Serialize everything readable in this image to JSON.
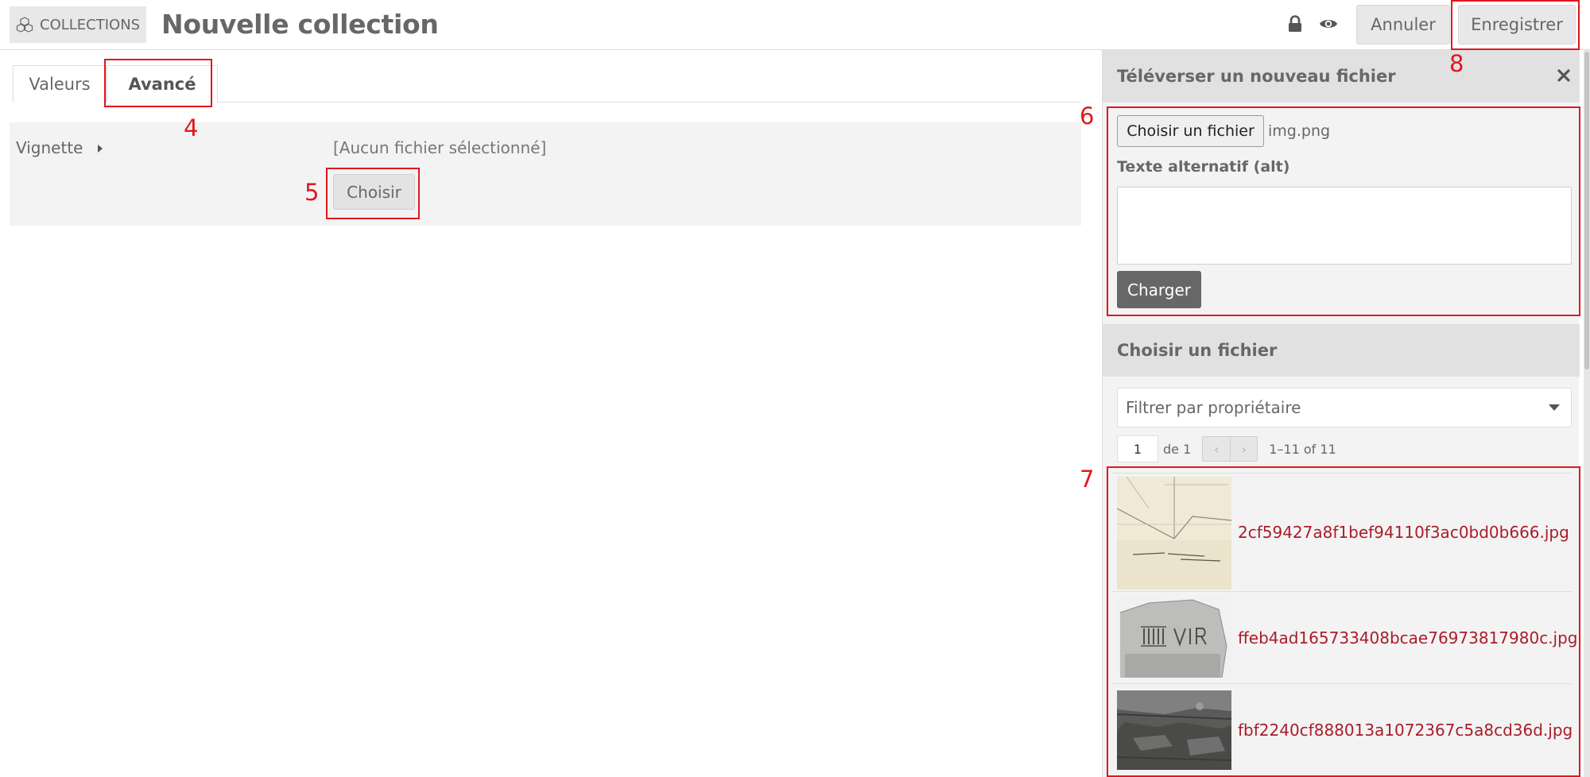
{
  "header": {
    "section_label": "COLLECTIONS",
    "section_icon": "collections-icon",
    "title": "Nouvelle collection",
    "cancel_label": "Annuler",
    "save_label": "Enregistrer"
  },
  "tabs": [
    {
      "label": "Valeurs",
      "active": false
    },
    {
      "label": "Avancé",
      "active": true
    }
  ],
  "thumbnail_field": {
    "label": "Vignette",
    "empty_text": "[Aucun fichier sélectionné]",
    "choose_label": "Choisir"
  },
  "sidebar": {
    "upload": {
      "title": "Téléverser un nouveau fichier",
      "file_button": "Choisir un fichier",
      "file_name": "img.png",
      "alt_label": "Texte alternatif (alt)",
      "alt_value": "",
      "submit_label": "Charger"
    },
    "chooser": {
      "title": "Choisir un fichier",
      "owner_filter": "Filtrer par propriétaire",
      "page": "1",
      "page_of": "de 1",
      "range": "1–11 of 11",
      "assets": [
        {
          "name": "2cf59427a8f1bef94110f3ac0bd0b666.jpg"
        },
        {
          "name": "ffeb4ad165733408bcae76973817980c.jpg"
        },
        {
          "name": "fbf2240cf888013a1072367c5a8cd36d.jpg"
        }
      ]
    }
  },
  "annotations": [
    "4",
    "5",
    "6",
    "7",
    "8"
  ],
  "colors": {
    "annotation": "#e0181c",
    "link": "#a91d2a",
    "text": "#676767",
    "panel": "#f3f3f3"
  }
}
